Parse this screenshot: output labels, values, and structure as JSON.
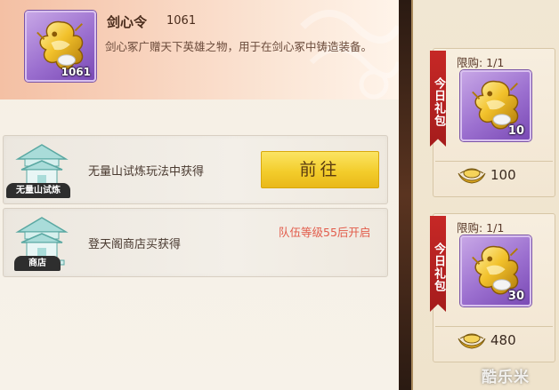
{
  "item": {
    "name": "剑心令",
    "count": "1061",
    "icon_count": "1061",
    "icon": "gold-dragon-icon",
    "description": "剑心冢广赠天下英雄之物，用于在剑心冢中铸造装备。"
  },
  "sources": [
    {
      "tag": "无量山试炼",
      "text": "无量山试炼玩法中获得",
      "action_label": "前往",
      "icon": "pavilion-icon"
    },
    {
      "tag": "商店",
      "text": "登天阁商店买获得",
      "locked_note": "队伍等级55后开启",
      "icon": "shop-pavilion-icon"
    }
  ],
  "gifts": [
    {
      "ribbon": "今日礼包",
      "limit": "限购: 1/1",
      "icon_count": "10",
      "price": "100",
      "currency_icon": "gold-ingot-icon"
    },
    {
      "ribbon": "今日礼包",
      "limit": "限购: 1/1",
      "icon_count": "30",
      "price": "480",
      "currency_icon": "gold-ingot-icon"
    }
  ],
  "watermark": "酷乐米",
  "colors": {
    "accent_button": "#f3cd2c",
    "locked_text": "#e25b4a",
    "ribbon": "#c62826",
    "icon_frame": "#9b6fcf"
  }
}
